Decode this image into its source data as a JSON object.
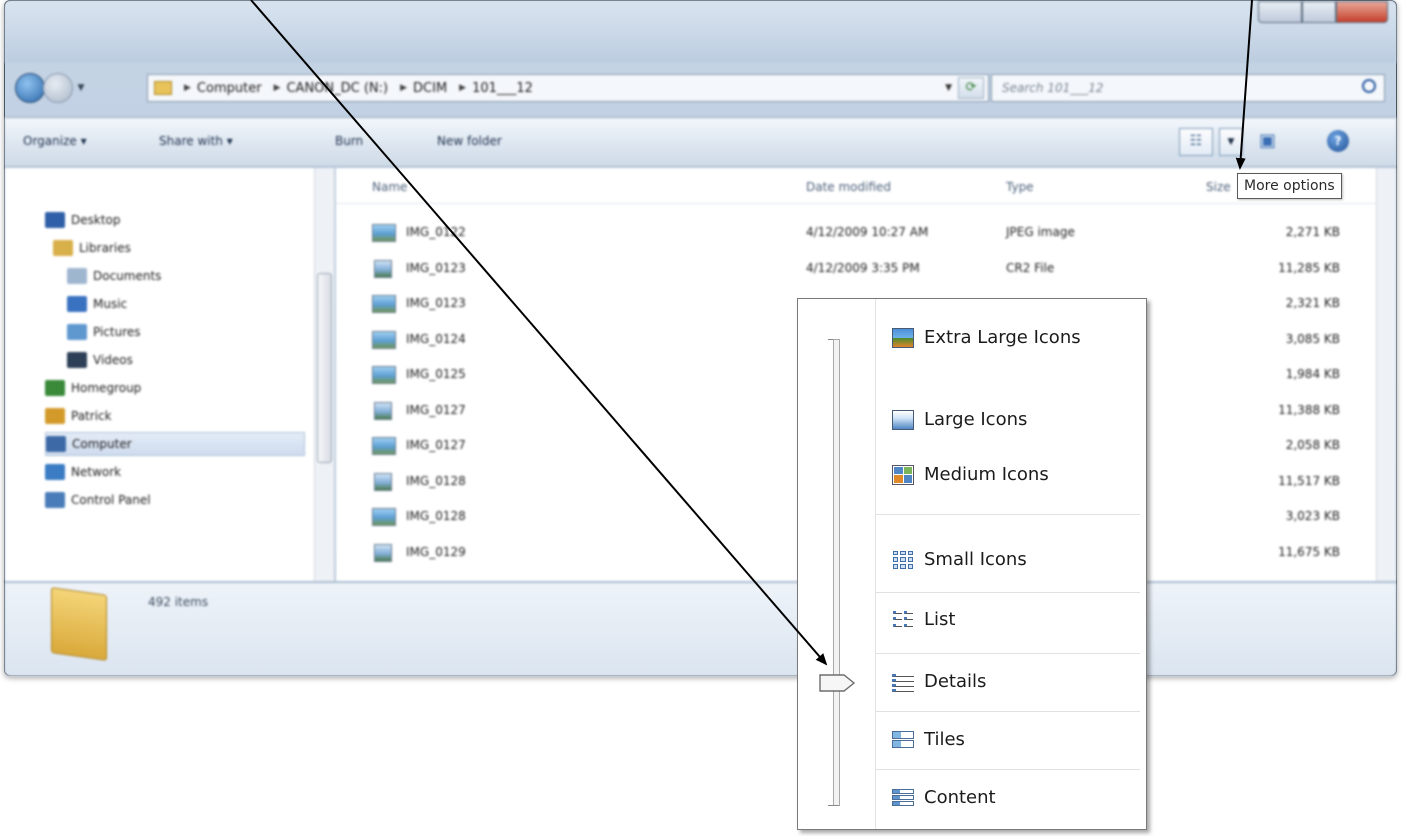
{
  "window": {
    "address": {
      "crumbs": [
        "Computer",
        "CANON_DC (N:)",
        "DCIM",
        "101___12"
      ]
    },
    "search": {
      "placeholder": "Search 101___12"
    },
    "toolbar": {
      "organize": "Organize ▾",
      "share_with": "Share with ▾",
      "burn": "Burn",
      "new_folder": "New folder"
    },
    "nav": {
      "items": [
        {
          "label": "Desktop",
          "icon": "desktop-icon",
          "color": "#2f5fa8"
        },
        {
          "label": "Libraries",
          "icon": "libraries-icon",
          "color": "#d8b04a"
        },
        {
          "label": "Documents",
          "icon": "documents-icon",
          "color": "#9fb6cf"
        },
        {
          "label": "Music",
          "icon": "music-icon",
          "color": "#3a72c2"
        },
        {
          "label": "Pictures",
          "icon": "pictures-icon",
          "color": "#5f98cf"
        },
        {
          "label": "Videos",
          "icon": "videos-icon",
          "color": "#2d4058"
        },
        {
          "label": "Homegroup",
          "icon": "homegroup-icon",
          "color": "#3a8a3a"
        },
        {
          "label": "Patrick",
          "icon": "user-icon",
          "color": "#d39a2a"
        },
        {
          "label": "Computer",
          "icon": "computer-icon",
          "color": "#3d6aa6"
        },
        {
          "label": "Network",
          "icon": "network-icon",
          "color": "#3b7cc4"
        },
        {
          "label": "Control Panel",
          "icon": "control-panel-icon",
          "color": "#4a7cb9"
        }
      ]
    },
    "columns": {
      "name": "Name",
      "date": "Date modified",
      "type": "Type",
      "size": "Size"
    },
    "files": [
      {
        "name": "IMG_0122",
        "date": "4/12/2009 10:27 AM",
        "type": "JPEG image",
        "size": "2,271 KB",
        "kind": "jpg"
      },
      {
        "name": "IMG_0123",
        "date": "4/12/2009 3:35 PM",
        "type": "CR2 File",
        "size": "11,285 KB",
        "kind": "cr2"
      },
      {
        "name": "IMG_0123",
        "date": "",
        "type": "",
        "size": "2,321 KB",
        "kind": "jpg"
      },
      {
        "name": "IMG_0124",
        "date": "",
        "type": "",
        "size": "3,085 KB",
        "kind": "jpg"
      },
      {
        "name": "IMG_0125",
        "date": "",
        "type": "",
        "size": "1,984 KB",
        "kind": "jpg"
      },
      {
        "name": "IMG_0127",
        "date": "",
        "type": "",
        "size": "11,388 KB",
        "kind": "cr2"
      },
      {
        "name": "IMG_0127",
        "date": "",
        "type": "",
        "size": "2,058 KB",
        "kind": "jpg"
      },
      {
        "name": "IMG_0128",
        "date": "",
        "type": "",
        "size": "11,517 KB",
        "kind": "cr2"
      },
      {
        "name": "IMG_0128",
        "date": "",
        "type": "",
        "size": "3,023 KB",
        "kind": "jpg"
      },
      {
        "name": "IMG_0129",
        "date": "",
        "type": "",
        "size": "11,675 KB",
        "kind": "cr2"
      }
    ],
    "status": {
      "count": "492 items"
    }
  },
  "tooltip": "More options",
  "view_menu": {
    "items": [
      {
        "label": "Extra Large Icons",
        "icon": "extra-large-icons-icon"
      },
      {
        "label": "Large Icons",
        "icon": "large-icons-icon"
      },
      {
        "label": "Medium Icons",
        "icon": "medium-icons-icon"
      },
      {
        "label": "Small Icons",
        "icon": "small-icons-icon"
      },
      {
        "label": "List",
        "icon": "list-icon"
      },
      {
        "label": "Details",
        "icon": "details-icon"
      },
      {
        "label": "Tiles",
        "icon": "tiles-icon"
      },
      {
        "label": "Content",
        "icon": "content-icon"
      }
    ],
    "selected": "Details"
  }
}
